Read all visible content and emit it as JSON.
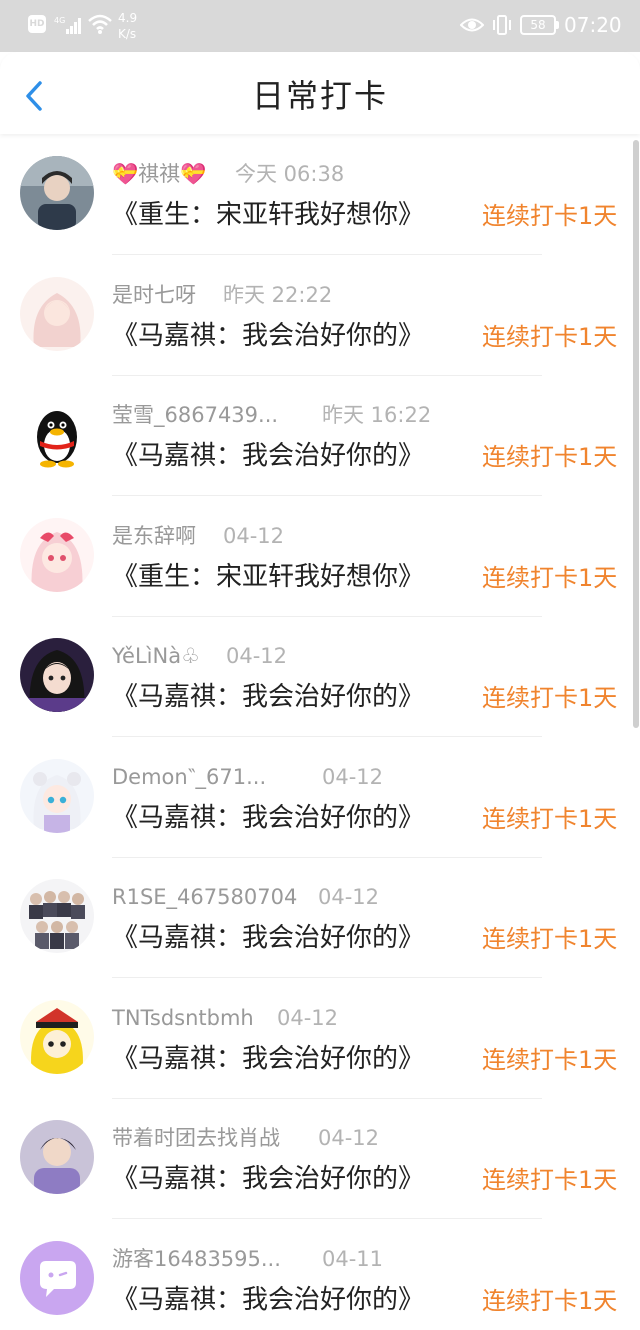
{
  "status_bar": {
    "hd": "HD",
    "network": "4G",
    "speed_value": "4.9",
    "speed_unit": "K/s",
    "battery": "58",
    "time": "07:20"
  },
  "header": {
    "title": "日常打卡",
    "back_icon": "chevron-left-icon"
  },
  "colors": {
    "accent": "#2e8fe8",
    "streak": "#f0842e",
    "name": "#999999",
    "date": "#b3b3b3",
    "status_bar_bg": "#d9d9d9"
  },
  "records": [
    {
      "name": "💝祺祺💝",
      "date": "今天 06:38",
      "book": "《重生：宋亚轩我好想你》",
      "streak": "连续打卡1天",
      "avatar": "photo-avatar"
    },
    {
      "name": "是时七呀",
      "date": "昨天 22:22",
      "book": "《马嘉祺：我会治好你的》",
      "streak": "连续打卡1天",
      "avatar": "anime-girl-avatar"
    },
    {
      "name": "莹雪_6867439...",
      "date": "昨天 16:22",
      "book": "《马嘉祺：我会治好你的》",
      "streak": "连续打卡1天",
      "avatar": "penguin-avatar"
    },
    {
      "name": "是东辞啊",
      "date": "04-12",
      "book": "《重生：宋亚轩我好想你》",
      "streak": "连续打卡1天",
      "avatar": "anime-girl-avatar"
    },
    {
      "name": "YěLìNà♧",
      "date": "04-12",
      "book": "《马嘉祺：我会治好你的》",
      "streak": "连续打卡1天",
      "avatar": "anime-girl-dark-avatar"
    },
    {
      "name": "Demon‶_671...",
      "date": "04-12",
      "book": "《马嘉祺：我会治好你的》",
      "streak": "连续打卡1天",
      "avatar": "anime-girl-avatar"
    },
    {
      "name": "R1SE_467580704",
      "date": "04-12",
      "book": "《马嘉祺：我会治好你的》",
      "streak": "连续打卡1天",
      "avatar": "group-photo-avatar"
    },
    {
      "name": "TNTsdsntbmh",
      "date": "04-12",
      "book": "《马嘉祺：我会治好你的》",
      "streak": "连续打卡1天",
      "avatar": "anime-boy-avatar"
    },
    {
      "name": "带着时团去找肖战",
      "date": "04-12",
      "book": "《马嘉祺：我会治好你的》",
      "streak": "连续打卡1天",
      "avatar": "photo-avatar"
    },
    {
      "name": "游客16483595...",
      "date": "04-11",
      "book": "《马嘉祺：我会治好你的》",
      "streak": "连续打卡1天",
      "avatar": "chat-bubble-avatar"
    }
  ]
}
